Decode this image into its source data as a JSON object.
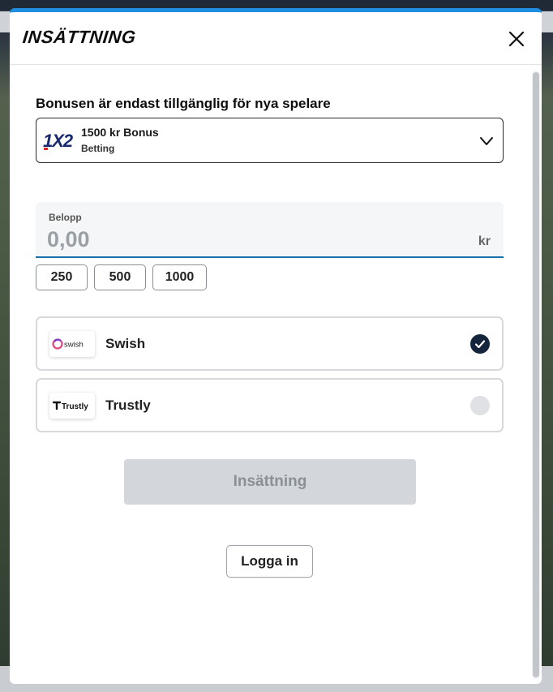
{
  "modal": {
    "title": "INSÄTTNING",
    "accent_color": "#1f8ee0"
  },
  "bonus": {
    "heading": "Bonusen är endast tillgänglig för nya spelare",
    "logo_text": "1X2",
    "title": "1500 kr Bonus",
    "subtitle": "Betting",
    "icon": "chevron-down-icon"
  },
  "amount": {
    "label": "Belopp",
    "placeholder": "0,00",
    "currency": "kr",
    "quick_amounts": [
      "250",
      "500",
      "1000"
    ]
  },
  "payment_methods": [
    {
      "name": "Swish",
      "logo_text": "swish",
      "selected": true
    },
    {
      "name": "Trustly",
      "logo_text": "Trustly",
      "selected": false
    }
  ],
  "actions": {
    "deposit_label": "Insättning",
    "login_label": "Logga in"
  },
  "colors": {
    "selected_radio": "#14243a",
    "input_underline": "#1b6fa8",
    "disabled_button": "#d3d6da"
  }
}
